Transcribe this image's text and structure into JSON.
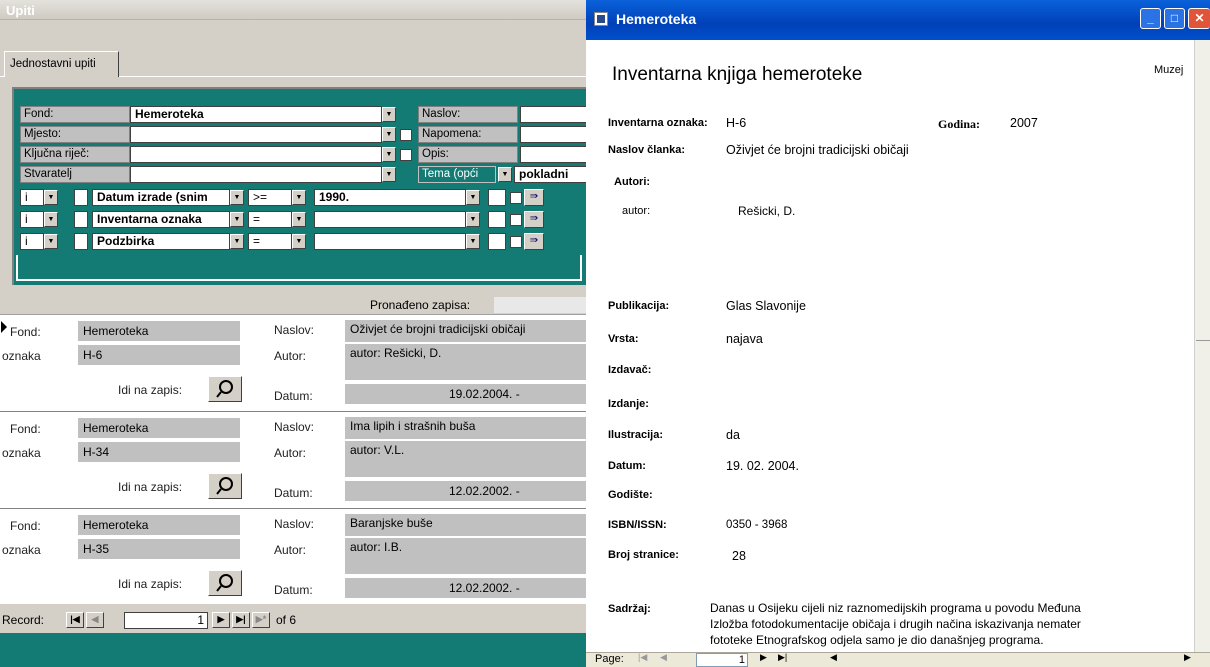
{
  "left_window": {
    "title": "Upiti",
    "tab": "Jednostavni upiti",
    "fields": [
      {
        "label": "Fond:",
        "value": "Hemeroteka"
      },
      {
        "label": "Mjesto:",
        "value": ""
      },
      {
        "label": "Ključna riječ:",
        "value": ""
      },
      {
        "label": "Stvaratelj",
        "value": ""
      }
    ],
    "side_labels": [
      "Naslov:",
      "Napomena:",
      "Opis:"
    ],
    "tema_label": "Tema (opći",
    "pokladni": "pokladni",
    "criteria": [
      {
        "logic": "i",
        "field": "Datum izrade (snim",
        "op": ">=",
        "value": "1990."
      },
      {
        "logic": "i",
        "field": "Inventarna oznaka",
        "op": "=",
        "value": ""
      },
      {
        "logic": "i",
        "field": "Podzbirka",
        "op": "=",
        "value": ""
      }
    ],
    "found_label": "Pronađeno zapisa:",
    "record_labels": {
      "fond": "Fond:",
      "oznaka": "oznaka",
      "goto": "Idi na zapis:",
      "naslov": "Naslov:",
      "autor": "Autor:",
      "datum": "Datum:"
    },
    "records": [
      {
        "fond": "Hemeroteka",
        "oznaka": "H-6",
        "naslov": "Oživjet će brojni tradicijski običaji",
        "autor": "autor: Rešicki, D.",
        "datum": "19.02.2004. -"
      },
      {
        "fond": "Hemeroteka",
        "oznaka": "H-34",
        "naslov": "Ima lipih i strašnih buša",
        "autor": "autor: V.L.",
        "datum": "12.02.2002. -"
      },
      {
        "fond": "Hemeroteka",
        "oznaka": "H-35",
        "naslov": "Baranjske buše",
        "autor": "autor: I.B.",
        "datum": "12.02.2002. -"
      }
    ],
    "nav": {
      "label": "Record:",
      "current": "1",
      "of": "of 6"
    }
  },
  "right_window": {
    "title": "Hemeroteka",
    "report_title": "Inventarna knjiga hemeroteke",
    "muzej": "Muzej",
    "inv_label": "Inventarna oznaka:",
    "inv_value": "H-6",
    "godina_label": "Godina:",
    "godina_value": "2007",
    "naslov_label": "Naslov članka:",
    "naslov_value": "Oživjet će brojni tradicijski običaji",
    "autori_label": "Autori:",
    "autor_role": "autor:",
    "autor_name": "Rešicki, D.",
    "pub_label": "Publikacija:",
    "pub_value": "Glas Slavonije",
    "vrsta_label": "Vrsta:",
    "vrsta_value": "najava",
    "izdavac_label": "Izdavač:",
    "izdanje_label": "Izdanje:",
    "ilustr_label": "Ilustracija:",
    "ilustr_value": "da",
    "datum_label": "Datum:",
    "datum_value": "19. 02. 2004.",
    "godiste_label": "Godište:",
    "isbn_label": "ISBN/ISSN:",
    "isbn_value": "0350 - 3968",
    "broj_label": "Broj stranice:",
    "broj_value": "28",
    "sadrzaj_label": "Sadržaj:",
    "sadrzaj_lines": [
      "Danas u Osijeku cijeli niz raznomedijskih programa u povodu Međuna",
      "Izložba fotodokumentacije običaja i drugih načina iskazivanja nemater",
      "fototeke Etnografskog odjela samo je dio današnjeg programa."
    ],
    "page_label": "Page:",
    "page_value": "1"
  }
}
